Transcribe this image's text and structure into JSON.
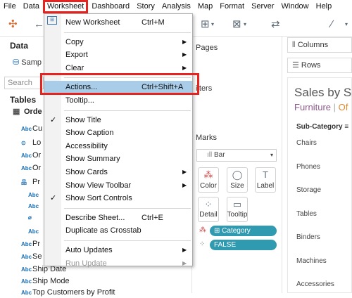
{
  "menubar": [
    "File",
    "Data",
    "Worksheet",
    "Dashboard",
    "Story",
    "Analysis",
    "Map",
    "Format",
    "Server",
    "Window",
    "Help"
  ],
  "left_pane": {
    "header": "Data",
    "source": "Samp",
    "search_placeholder": "Search",
    "tables_label": "Tables",
    "fields": [
      {
        "icon": "table",
        "label": "Orde"
      },
      {
        "icon": "Abc",
        "label": "Cu"
      },
      {
        "icon": "geo",
        "label": "Lo"
      },
      {
        "icon": "Abc",
        "label": "Or"
      },
      {
        "icon": "Abc",
        "label": "Or"
      },
      {
        "icon": "hier",
        "label": "Pr"
      },
      {
        "icon": "Abc",
        "label": ""
      },
      {
        "icon": "Abc",
        "label": ""
      },
      {
        "icon": "clip",
        "label": ""
      },
      {
        "icon": "Abc",
        "label": ""
      },
      {
        "icon": "Abc",
        "label": "Pr"
      },
      {
        "icon": "Abc",
        "label": "Se"
      },
      {
        "icon": "Abc",
        "label": "Ship Date"
      },
      {
        "icon": "Abc",
        "label": "Ship Mode"
      },
      {
        "icon": "Abc",
        "label": "Top Customers by Profit"
      }
    ]
  },
  "cards": {
    "pages": "Pages",
    "filters": "ilters",
    "marks": "Marks",
    "mark_type": "Bar",
    "mark_buttons": [
      "Color",
      "Size",
      "Label",
      "Detail",
      "Tooltip"
    ],
    "pills": [
      "Category",
      "FALSE"
    ]
  },
  "shelves": {
    "columns": "Columns",
    "rows": "Rows"
  },
  "canvas": {
    "title": "Sales by Su",
    "subtitle_a": "Furniture",
    "subtitle_sep": "|",
    "subtitle_b": "Of",
    "subcategory_header": "Sub-Category",
    "rows": [
      "Chairs",
      "Phones",
      "Storage",
      "Tables",
      "Binders",
      "Machines",
      "Accessories"
    ]
  },
  "worksheet_menu": {
    "items": [
      {
        "label": "New Worksheet",
        "shortcut": "Ctrl+M",
        "arrow": false,
        "check": false,
        "disabled": false,
        "highlight": false
      },
      {
        "sep": true
      },
      {
        "label": "Copy",
        "shortcut": "",
        "arrow": true,
        "check": false,
        "disabled": false,
        "highlight": false
      },
      {
        "label": "Export",
        "shortcut": "",
        "arrow": true,
        "check": false,
        "disabled": false,
        "highlight": false
      },
      {
        "label": "Clear",
        "shortcut": "",
        "arrow": true,
        "check": false,
        "disabled": false,
        "highlight": false
      },
      {
        "sep": true
      },
      {
        "label": "Actions...",
        "shortcut": "Ctrl+Shift+A",
        "arrow": false,
        "check": false,
        "disabled": false,
        "highlight": true
      },
      {
        "label": "Tooltip...",
        "shortcut": "",
        "arrow": false,
        "check": false,
        "disabled": false,
        "highlight": false
      },
      {
        "sep": true
      },
      {
        "label": "Show Title",
        "shortcut": "",
        "arrow": false,
        "check": true,
        "disabled": false,
        "highlight": false
      },
      {
        "label": "Show Caption",
        "shortcut": "",
        "arrow": false,
        "check": false,
        "disabled": false,
        "highlight": false
      },
      {
        "label": "Accessibility",
        "shortcut": "",
        "arrow": false,
        "check": false,
        "disabled": false,
        "highlight": false
      },
      {
        "label": "Show Summary",
        "shortcut": "",
        "arrow": false,
        "check": false,
        "disabled": false,
        "highlight": false
      },
      {
        "label": "Show Cards",
        "shortcut": "",
        "arrow": true,
        "check": false,
        "disabled": false,
        "highlight": false
      },
      {
        "label": "Show View Toolbar",
        "shortcut": "",
        "arrow": true,
        "check": false,
        "disabled": false,
        "highlight": false
      },
      {
        "label": "Show Sort Controls",
        "shortcut": "",
        "arrow": false,
        "check": true,
        "disabled": false,
        "highlight": false
      },
      {
        "sep": true
      },
      {
        "label": "Describe Sheet...",
        "shortcut": "Ctrl+E",
        "arrow": false,
        "check": false,
        "disabled": false,
        "highlight": false
      },
      {
        "label": "Duplicate as Crosstab",
        "shortcut": "",
        "arrow": false,
        "check": false,
        "disabled": false,
        "highlight": false
      },
      {
        "sep": true
      },
      {
        "label": "Auto Updates",
        "shortcut": "",
        "arrow": true,
        "check": false,
        "disabled": false,
        "highlight": false
      },
      {
        "label": "Run Update",
        "shortcut": "",
        "arrow": true,
        "check": false,
        "disabled": true,
        "highlight": false
      }
    ]
  },
  "colors": {
    "highlight": "#a9cce8",
    "annotation_red": "#e8231f",
    "pill_teal": "#2f9ab0",
    "furniture": "#8c5a8a",
    "office": "#e08a2c"
  }
}
